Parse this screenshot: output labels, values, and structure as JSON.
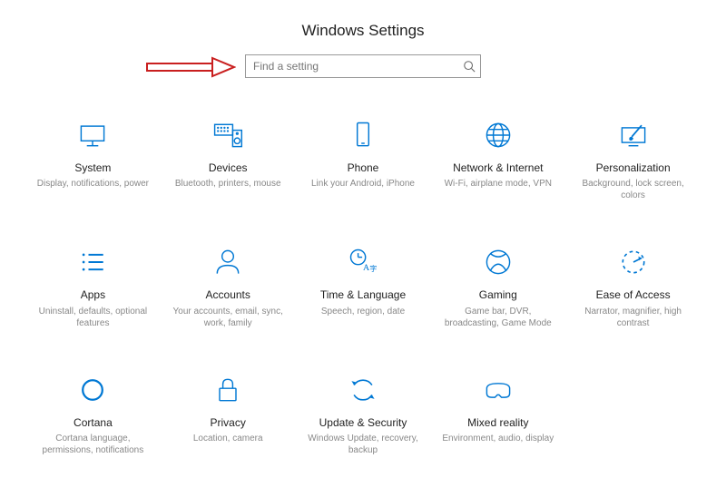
{
  "title": "Windows Settings",
  "search": {
    "placeholder": "Find a setting"
  },
  "tiles": [
    {
      "key": "system",
      "title": "System",
      "sub": "Display, notifications, power"
    },
    {
      "key": "devices",
      "title": "Devices",
      "sub": "Bluetooth, printers, mouse"
    },
    {
      "key": "phone",
      "title": "Phone",
      "sub": "Link your Android, iPhone"
    },
    {
      "key": "network",
      "title": "Network & Internet",
      "sub": "Wi-Fi, airplane mode, VPN"
    },
    {
      "key": "personalization",
      "title": "Personalization",
      "sub": "Background, lock screen, colors"
    },
    {
      "key": "apps",
      "title": "Apps",
      "sub": "Uninstall, defaults, optional features"
    },
    {
      "key": "accounts",
      "title": "Accounts",
      "sub": "Your accounts, email, sync, work, family"
    },
    {
      "key": "time",
      "title": "Time & Language",
      "sub": "Speech, region, date"
    },
    {
      "key": "gaming",
      "title": "Gaming",
      "sub": "Game bar, DVR, broadcasting, Game Mode"
    },
    {
      "key": "ease",
      "title": "Ease of Access",
      "sub": "Narrator, magnifier, high contrast"
    },
    {
      "key": "cortana",
      "title": "Cortana",
      "sub": "Cortana language, permissions, notifications"
    },
    {
      "key": "privacy",
      "title": "Privacy",
      "sub": "Location, camera"
    },
    {
      "key": "update",
      "title": "Update & Security",
      "sub": "Windows Update, recovery, backup"
    },
    {
      "key": "mixed",
      "title": "Mixed reality",
      "sub": "Environment, audio, display"
    }
  ],
  "icon_names": {
    "system": "display-icon",
    "devices": "keyboard-speaker-icon",
    "phone": "phone-icon",
    "network": "globe-icon",
    "personalization": "paintbrush-monitor-icon",
    "apps": "list-icon",
    "accounts": "person-icon",
    "time": "clock-language-icon",
    "gaming": "xbox-icon",
    "ease": "dashed-clock-arrow-icon",
    "cortana": "cortana-circle-icon",
    "privacy": "lock-icon",
    "update": "sync-arrows-icon",
    "mixed": "headset-icon"
  },
  "accent_color": "#0078d4",
  "arrow_color": "#c91f1f"
}
